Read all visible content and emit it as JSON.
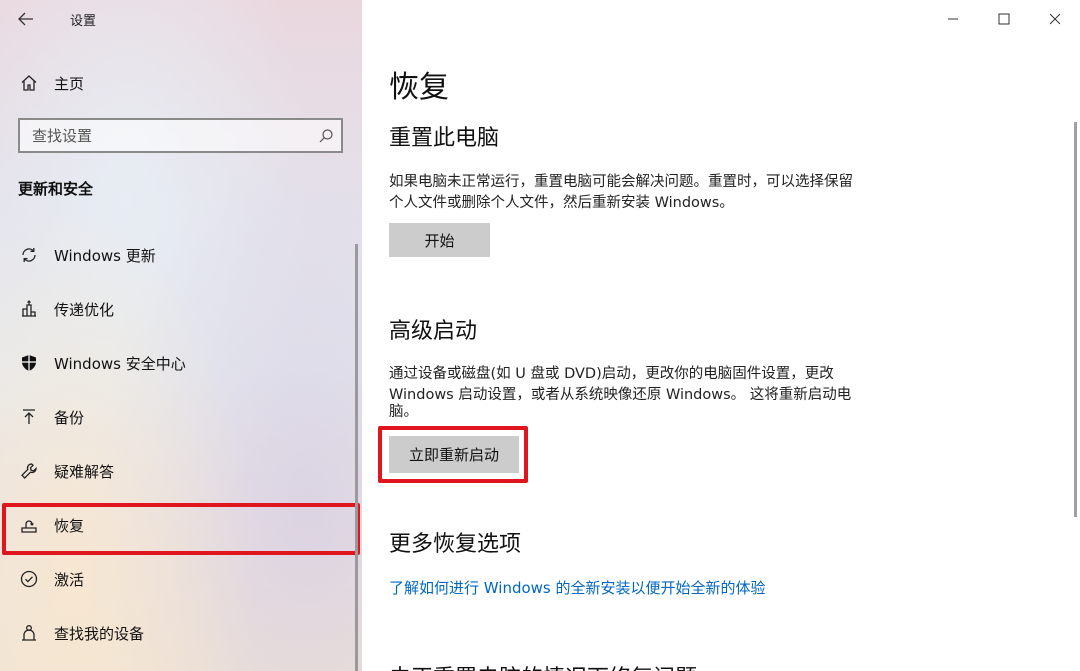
{
  "app": {
    "title": "设置"
  },
  "sidebar": {
    "home_label": "主页",
    "search": {
      "placeholder": "查找设置",
      "value": ""
    },
    "section_heading": "更新和安全",
    "items": [
      {
        "label": "Windows 更新",
        "icon": "sync-icon"
      },
      {
        "label": "传递优化",
        "icon": "delivery-optimization-icon"
      },
      {
        "label": "Windows 安全中心",
        "icon": "shield-icon"
      },
      {
        "label": "备份",
        "icon": "backup-arrow-icon"
      },
      {
        "label": "疑难解答",
        "icon": "wrench-icon"
      },
      {
        "label": "恢复",
        "icon": "recovery-icon",
        "selected": true
      },
      {
        "label": "激活",
        "icon": "check-circle-icon"
      },
      {
        "label": "查找我的设备",
        "icon": "person-location-icon"
      }
    ]
  },
  "main": {
    "title": "恢复",
    "reset": {
      "heading": "重置此电脑",
      "desc_line1": "如果电脑未正常运行，重置电脑可能会解决问题。重置时，可以选择保留",
      "desc_line2": "个人文件或删除个人文件，然后重新安装 Windows。",
      "button": "开始"
    },
    "advanced": {
      "heading": "高级启动",
      "desc_line1": "通过设备或磁盘(如 U 盘或 DVD)启动，更改你的电脑固件设置，更改",
      "desc_line2": "Windows 启动设置，或者从系统映像还原 Windows。 这将重新启动电",
      "desc_line3": "脑。",
      "button": "立即重新启动"
    },
    "more": {
      "heading": "更多恢复选项",
      "link": "了解如何进行 Windows 的全新安装以便开始全新的体验"
    },
    "cut_heading": "未正重置电脑的情况下修复问题"
  },
  "colors": {
    "highlight": "#e0161e",
    "link": "#0067c0",
    "button_bg": "#cccccc"
  }
}
